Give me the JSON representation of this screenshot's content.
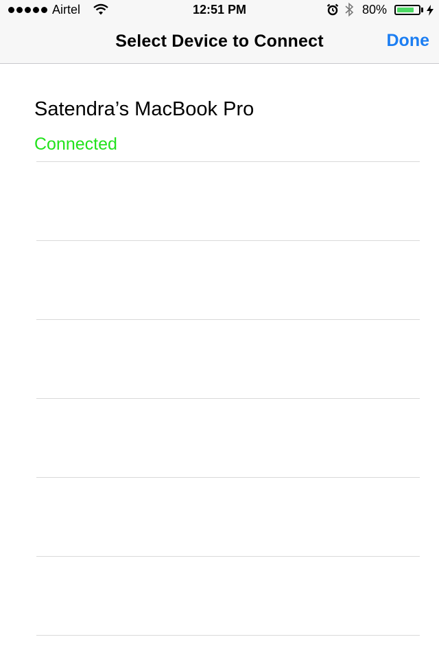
{
  "status_bar": {
    "carrier": "Airtel",
    "time": "12:51 PM",
    "battery_percent": "80%",
    "battery_level": 0.8,
    "battery_fill_color": "#4cd964"
  },
  "nav": {
    "title": "Select Device to Connect",
    "done_label": "Done",
    "accent_color": "#1c7ef2"
  },
  "devices": [
    {
      "name": "Satendra’s MacBook Pro",
      "status": "Connected",
      "status_color": "#22e21c"
    }
  ],
  "empty_rows": 6,
  "icons": [
    "signal-dots-icon",
    "wifi-icon",
    "alarm-icon",
    "bluetooth-icon",
    "battery-icon",
    "charging-bolt-icon"
  ]
}
